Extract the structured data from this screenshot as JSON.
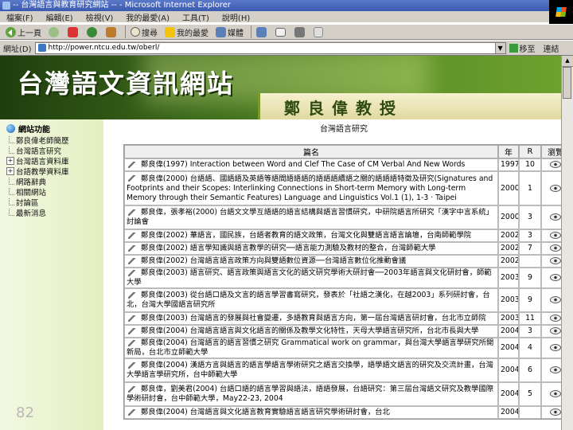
{
  "window": {
    "title": "-- 台灣語言與教育研究網站 -- - Microsoft Internet Explorer"
  },
  "menu": [
    "檔案(F)",
    "編輯(E)",
    "檢視(V)",
    "我的最愛(A)",
    "工具(T)",
    "說明(H)"
  ],
  "toolbar": {
    "back": "上一頁",
    "search": "搜尋",
    "favorites": "我的最愛",
    "media": "媒體"
  },
  "address": {
    "label": "網址(D)",
    "url": "http://power.ntcu.edu.tw/oberl/",
    "go": "移至",
    "links": "連結"
  },
  "banner": {
    "site_title": "台灣語文資訊網站",
    "professor": "鄭良偉教授"
  },
  "nav": {
    "title": "網站功能",
    "items": [
      "鄭良偉老師簡歷",
      "台灣語言研究",
      "台灣語言資料庫",
      "台語教學資料庫",
      "網路辭典",
      "相關網站",
      "討論區",
      "最新消息"
    ],
    "slide_number": "82"
  },
  "main": {
    "section_title": "台灣語言研究",
    "columns": [
      "篇名",
      "年",
      "R",
      "瀏覽"
    ],
    "rows": [
      {
        "title": "鄭良偉(1997) Interaction between Word and Clef The Case of CM Verbal And New Words",
        "year": "1997",
        "r": "10"
      },
      {
        "title": "鄭良偉(2000) 台語語、國語語及英語等語間語語語的語語語續語之關的語語語特徵及研究(Signatures and Footprints and their Scopes: Interlinking Connections in Short-term Memory with Long-term Memory through their Semantic Features) Language and Linguistics Vol.1 (1), 1-3 · Taipei",
        "year": "2000",
        "r": "1"
      },
      {
        "title": "鄭良偉，張孝裕(2000) 台語文文學互語語的語言結構與語言習慣研究，中研院語言所研究「漢字中言系統」討論會",
        "year": "2000",
        "r": "3"
      },
      {
        "title": "鄭良偉(2002) 華語言，國民族，台語者教育的語文政策，台灣文化與雙語言語言論壇，台南師範學院",
        "year": "2002",
        "r": "3"
      },
      {
        "title": "鄭良偉(2002) 語言學知識與語言教學的研究──語言能力測驗及教材的整合，台灣師範大學",
        "year": "2002",
        "r": "7"
      },
      {
        "title": "鄭良偉(2002) 台灣語言語言政策方向與雙語數位資源──台灣語言數位化推動會議",
        "year": "2002",
        "r": ""
      },
      {
        "title": "鄭良偉(2003) 語言研究、語言政策與語言文化的語文研究學術大研討會──2003年語言與文化研討會，師範大學",
        "year": "2003",
        "r": "9"
      },
      {
        "title": "鄭良偉(2003) 從台語口語及文言的語言學習書寫研究，發表於「社語之漢化，在越2003」系列研討會，台北，台灣大學國語言研究所",
        "year": "2003",
        "r": "9"
      },
      {
        "title": "鄭良偉(2003) 台灣語言的發展與社會變遷，多語教育與語言方向，第一屆台灣語言研討會，台北市立師院",
        "year": "2003",
        "r": "11"
      },
      {
        "title": "鄭良偉(2004) 台灣語言語言與文化語言的關係及教學文化特性，天母大學語言研究所，台北市長與大學",
        "year": "2004",
        "r": "3"
      },
      {
        "title": "鄭良偉(2004) 台灣語言的語言習慣之研究 Grammatical work on grammar，與台灣大學語言學研究所開新局，台北市立師範大學",
        "year": "2004",
        "r": "4"
      },
      {
        "title": "鄭良偉(2004) 漢語方言與語言的語言學語言學術研究之語言交換學，語學語文語言的研究及交流計畫，台灣大學語言學研究所，台中師範大學",
        "year": "2004",
        "r": "6"
      },
      {
        "title": "鄭良偉，劉美君(2004) 台語口語的語言學習與語法，語語發展，台語研究：第三屆台灣語文研究及教學國際學術研討會，台中師範大學，May22-23, 2004",
        "year": "2004",
        "r": "5"
      },
      {
        "title": "鄭良偉(2004) 台灣語言與文化語言教育實驗語言語言研究學術研討會，台北",
        "year": "2004",
        "r": ""
      }
    ]
  }
}
